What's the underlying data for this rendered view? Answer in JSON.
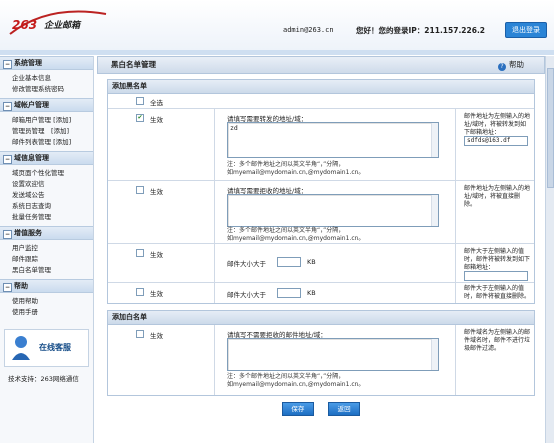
{
  "header": {
    "logo_text": "263企业邮箱",
    "admin": "admin@263.cn",
    "greeting": "您好！您的登录IP：211.157.226.2",
    "logout": "退出登录"
  },
  "sidebar": [
    {
      "title": "系统管理",
      "items": [
        "企业基本信息",
        "修改管理系统密码"
      ]
    },
    {
      "title": "域帐户管理",
      "items": [
        "邮箱用户管理 [添加]",
        "管理员管理　[添加]",
        "邮件列表管理 [添加]"
      ]
    },
    {
      "title": "域信息管理",
      "items": [
        "域页面个性化管理",
        "设置欢迎信",
        "发送域公告",
        "系统日志查询",
        "批量任务管理"
      ]
    },
    {
      "title": "增值服务",
      "items": [
        "用户监控",
        "邮件跟踪",
        "黑白名单管理"
      ]
    },
    {
      "title": "帮助",
      "items": [
        "使用帮助",
        "使用手册"
      ]
    }
  ],
  "online_service": "在线客服",
  "tech_support": "技术支持：263网络通信",
  "main": {
    "title": "黑白名单管理",
    "help": "帮助"
  },
  "blacklist": {
    "title": "添加黑名单",
    "select_all": "全选",
    "effective": "生效",
    "forward_prompt": "请填写需要转发的地址/域：",
    "forward_value": "zd",
    "reject_prompt": "请填写需要拒收的地址/域：",
    "hint1": "注：多个邮件地址之间以英文半角“，”分隔，",
    "hint2": "如myemail@mydomain.cn,@mydomain1.cn。",
    "note1": "邮件地址为左侧输入的地址/域时，将被转发到如下邮箱地址：",
    "forward_to": "sdfds@163.df",
    "note2": "邮件地址为左侧输入的地址/域时，将被直接删除。",
    "size_label": "邮件大小大于",
    "size_unit": "KB",
    "note3": "邮件大于左侧输入的值时，邮件将被转发到如下邮箱地址：",
    "note4": "邮件大于左侧输入的值时，邮件将被直接删除。"
  },
  "whitelist": {
    "title": "添加白名单",
    "effective": "生效",
    "prompt": "请填写不需要拒收的邮件地址/域：",
    "hint1": "注：多个邮件地址之间以英文半角“，”分隔，",
    "hint2": "如myemail@mydomain.cn,@mydomain1.cn。",
    "note": "邮件域名为左侧输入的邮件域名时，邮件不进行垃圾邮件过滤。"
  },
  "buttons": {
    "save": "保存",
    "cancel": "返回"
  }
}
